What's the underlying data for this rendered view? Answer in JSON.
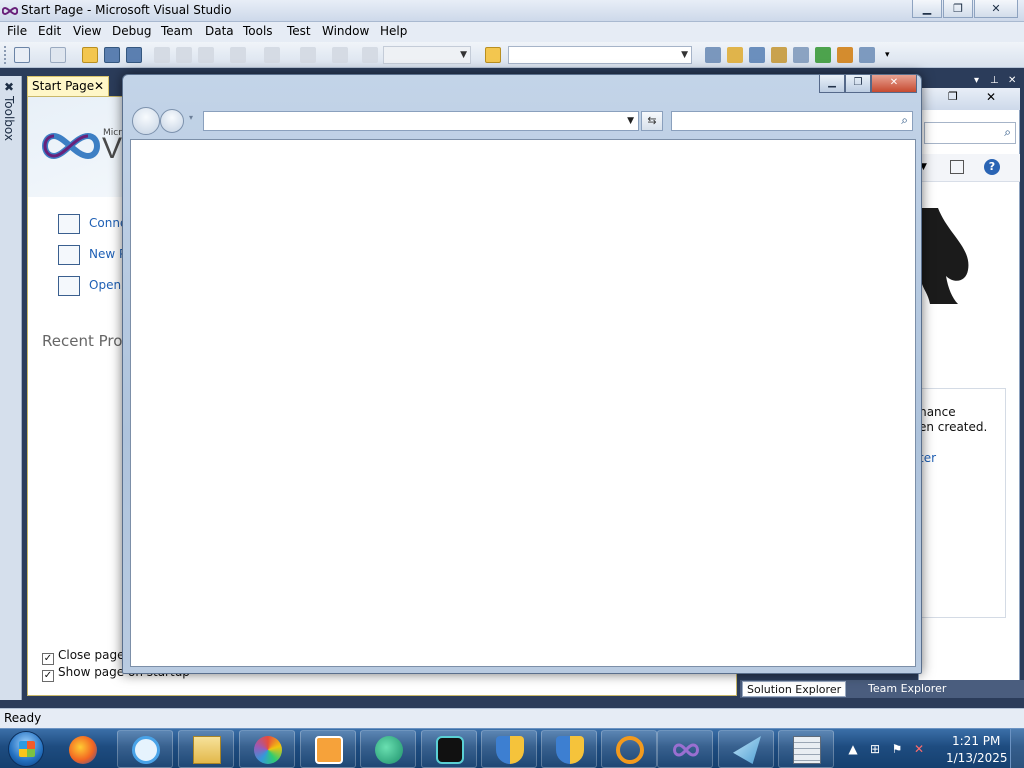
{
  "vs": {
    "title": "Start Page - Microsoft Visual Studio",
    "menu": [
      "File",
      "Edit",
      "View",
      "Debug",
      "Team",
      "Data",
      "Tools",
      "Test",
      "Window",
      "Help"
    ],
    "toolbox_label": "Toolbox",
    "tab_title": "Start Page",
    "tab_close": "✕",
    "brand_small": "Micr",
    "brand_big": "V",
    "links": [
      "Conne",
      "New P",
      "Open"
    ],
    "recent_title": "Recent Proj",
    "checkbox_close": "Close page a",
    "checkbox_show": "Show page on startup",
    "right_panel": {
      "text_line1": "mance",
      "text_line2": "en created.",
      "link": "ter"
    },
    "bottom_tabs": [
      "Solution Explorer",
      "Team Explorer"
    ],
    "status": "Ready"
  },
  "ie": {
    "address_value": "",
    "search_value": ""
  },
  "taskbar": {
    "apps": [
      "firefox",
      "internet-explorer",
      "file-explorer",
      "paint",
      "media-player",
      "chat-app",
      "nox-player",
      "security-shield",
      "security-shield-2",
      "search-tool",
      "visual-studio",
      "mail-app",
      "calculator"
    ],
    "time": "1:21 PM",
    "date": "1/13/2025"
  },
  "colors": {
    "accent": "#1f60b5",
    "vs_purple": "#68217a",
    "ie_close": "#c64a30",
    "taskbar": "#1e4c80"
  }
}
